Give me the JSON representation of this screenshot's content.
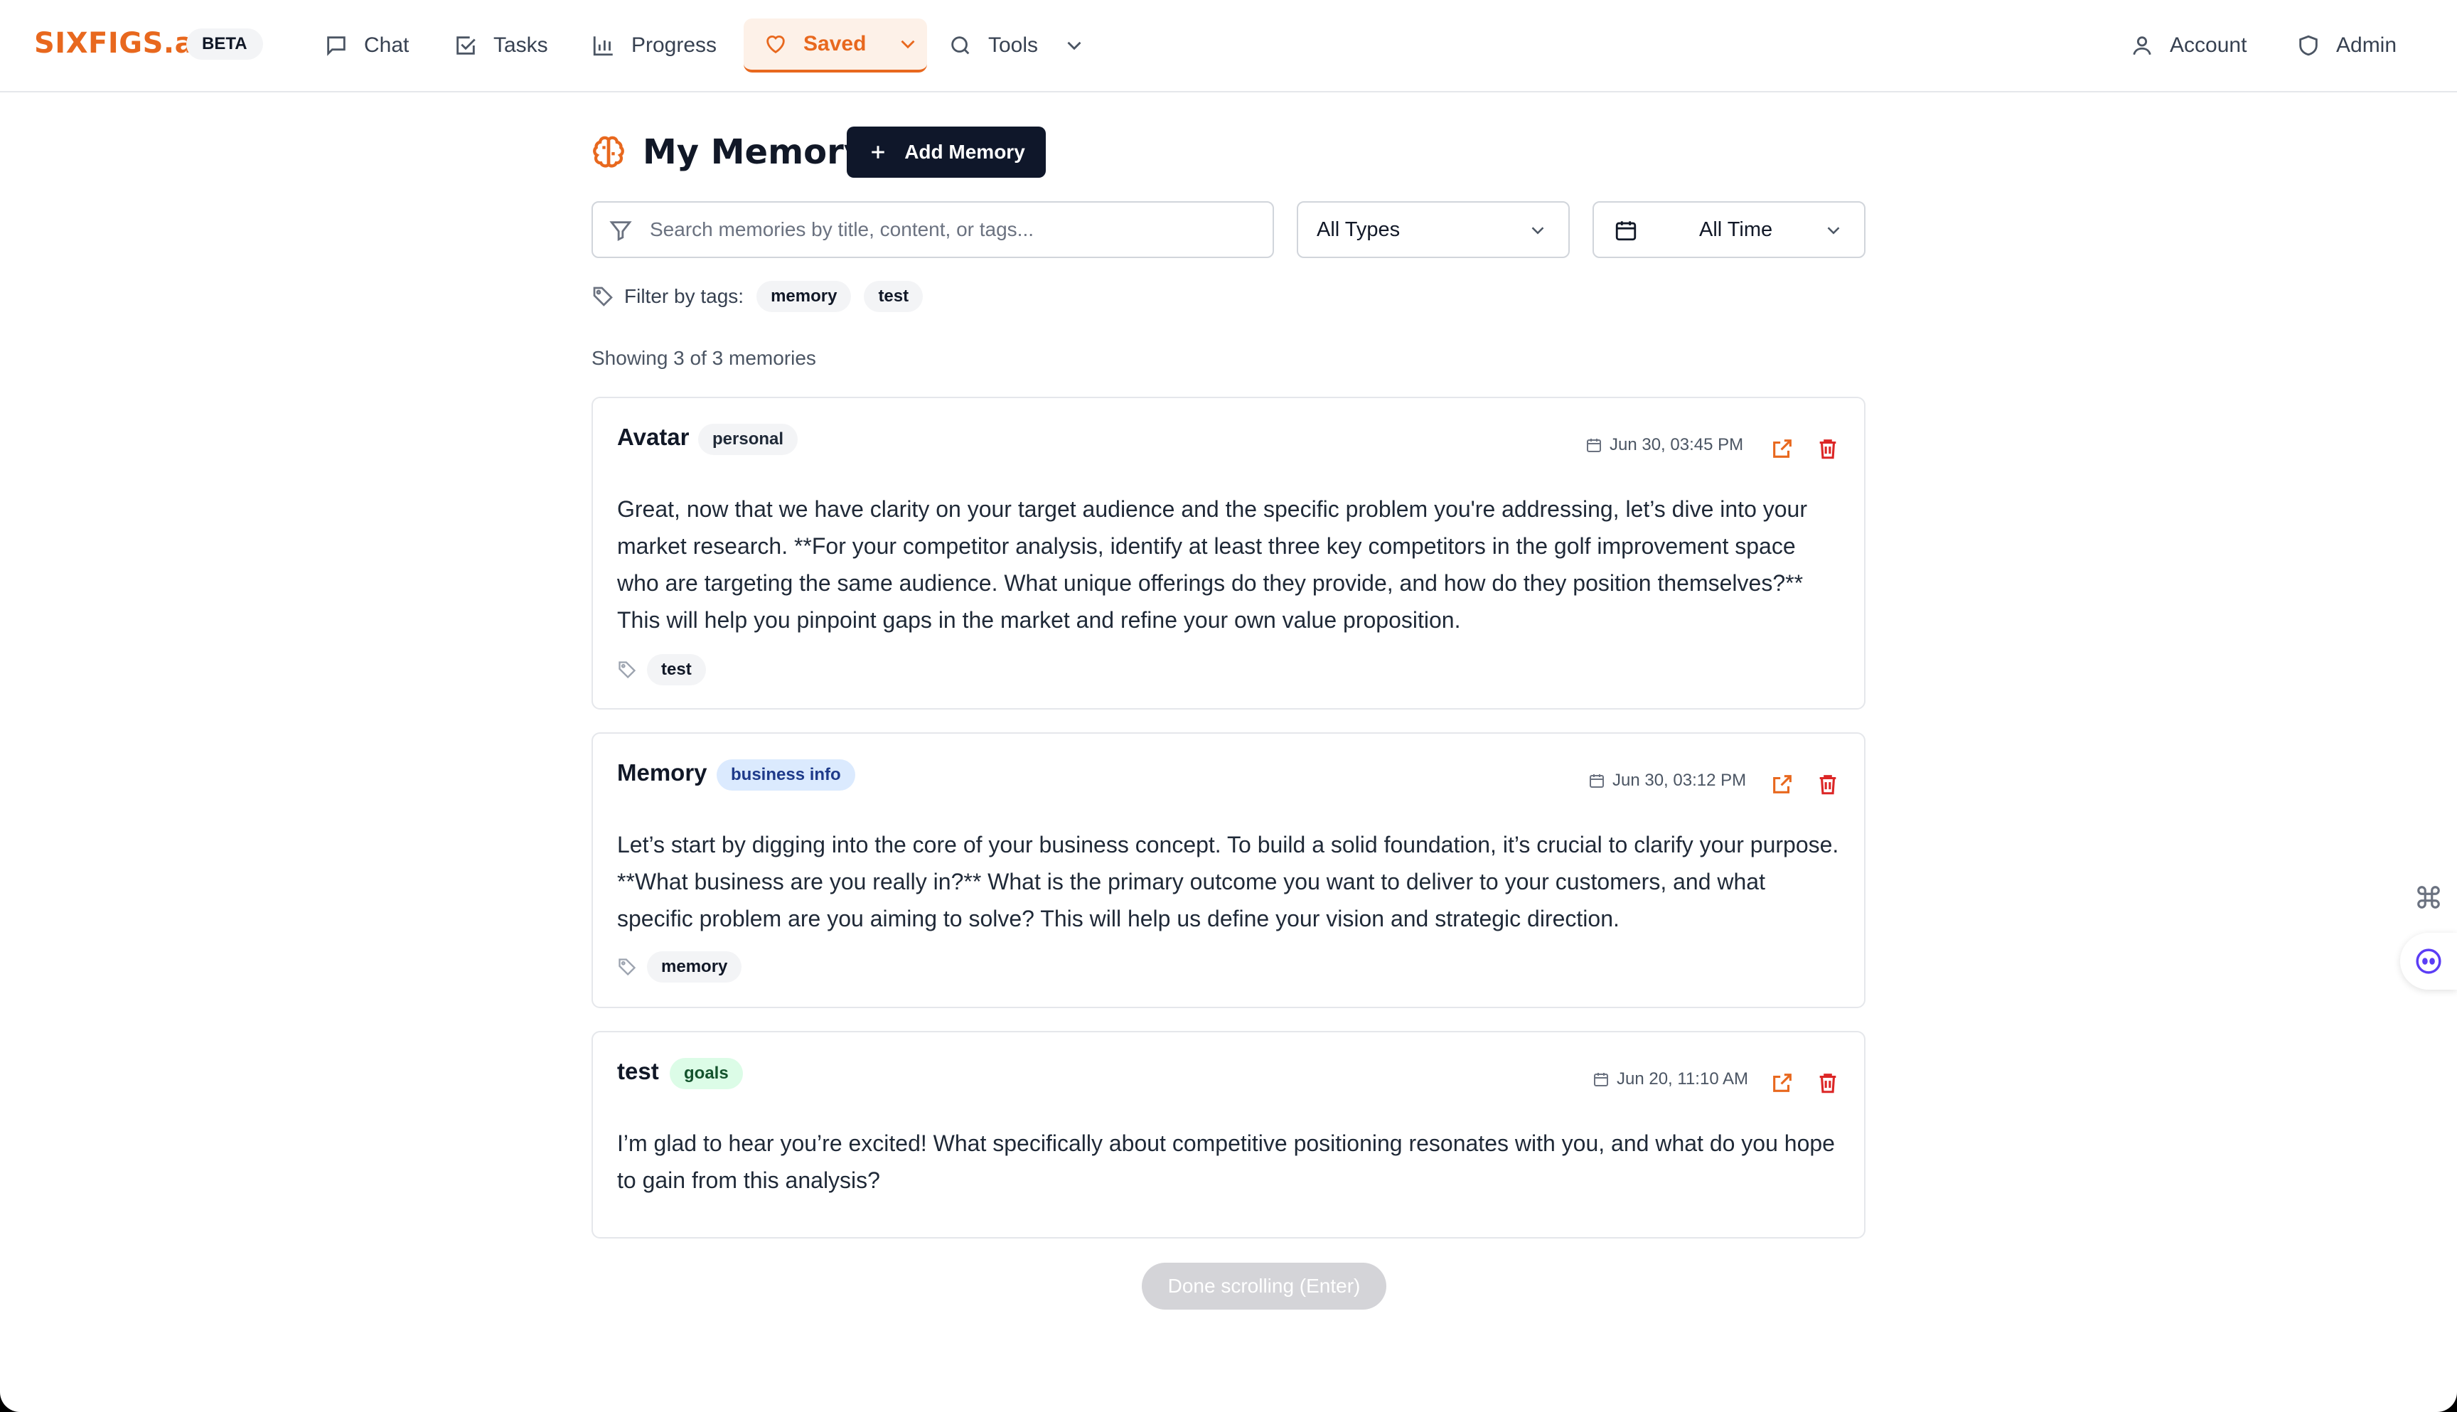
{
  "brand": {
    "logo": "SIXFIGS.ai",
    "badge": "BETA"
  },
  "nav": {
    "chat": "Chat",
    "tasks": "Tasks",
    "progress": "Progress",
    "saved": "Saved",
    "tools": "Tools",
    "account": "Account",
    "admin": "Admin"
  },
  "colors": {
    "accent": "#e8681e",
    "dark_button": "#0f172a",
    "danger": "#dc2626"
  },
  "page": {
    "title": "My Memory",
    "add_button": "Add Memory"
  },
  "filters": {
    "search_placeholder": "Search memories by title, content, or tags...",
    "type_select": "All Types",
    "time_select": "All Time",
    "tags_label": "Filter by tags:",
    "tags": [
      "memory",
      "test"
    ]
  },
  "results_count": "Showing 3 of 3 memories",
  "memories": [
    {
      "title": "Avatar",
      "category": "personal",
      "date": "Jun 30, 03:45 PM",
      "content": "Great, now that we have clarity on your target audience and the specific problem you're addressing, let’s dive into your market research. **For your competitor analysis, identify at least three key competitors in the golf improvement space who are targeting the same audience. What unique offerings do they provide, and how do they position themselves?** This will help you pinpoint gaps in the market and refine your own value proposition.",
      "tags": [
        "test"
      ]
    },
    {
      "title": "Memory",
      "category": "business info",
      "date": "Jun 30, 03:12 PM",
      "content": "Let’s start by digging into the core of your business concept. To build a solid foundation, it’s crucial to clarify your purpose. **What business are you really in?** What is the primary outcome you want to deliver to your customers, and what specific problem are you aiming to solve? This will help us define your vision and strategic direction.",
      "tags": [
        "memory"
      ]
    },
    {
      "title": "test",
      "category": "goals",
      "date": "Jun 20, 11:10 AM",
      "content": "I’m glad to hear you’re excited! What specifically about competitive positioning resonates with you, and what do you hope to gain from this analysis?",
      "tags": []
    }
  ],
  "done_button": "Done scrolling (Enter)",
  "icons": [
    "chat-icon",
    "tasks-icon",
    "progress-icon",
    "heart-icon",
    "search-icon",
    "chevron-down-icon",
    "user-icon",
    "shield-icon",
    "brain-icon",
    "plus-icon",
    "filter-icon",
    "calendar-icon",
    "tag-icon",
    "external-link-icon",
    "trash-icon",
    "command-icon",
    "assistant-icon"
  ]
}
